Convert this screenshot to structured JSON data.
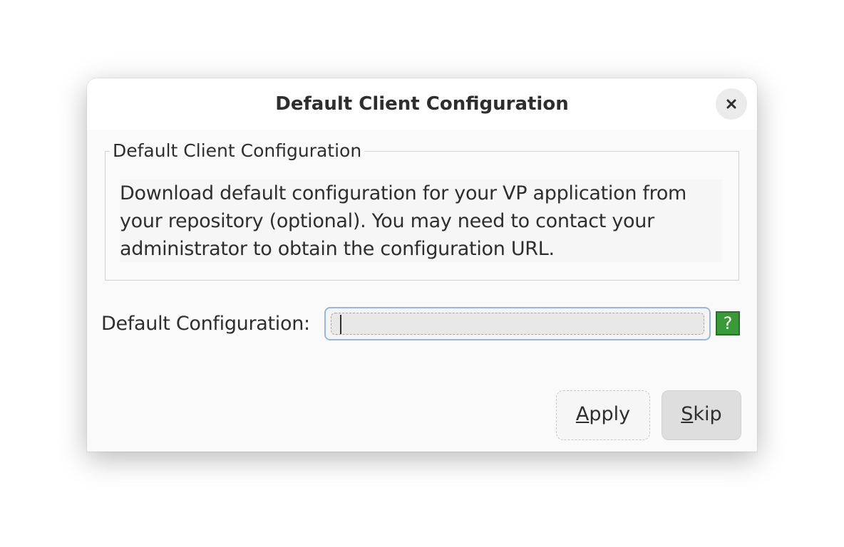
{
  "dialog": {
    "title": "Default Client Configuration",
    "close_icon": "close-icon"
  },
  "group": {
    "legend": "Default Client Configuration",
    "description_lines": [
      "Download default configuration for your VP application from",
      "your repository (optional). You may need to contact your",
      "administrator to obtain the configuration URL."
    ]
  },
  "field": {
    "label": "Default Configuration:",
    "value": "",
    "help_label": "?",
    "help_icon": "help-icon"
  },
  "buttons": {
    "apply_mnemonic": "A",
    "apply_rest": "pply",
    "skip_mnemonic": "S",
    "skip_rest": "kip"
  },
  "colors": {
    "help_button": "#3a9a3a",
    "input_focus_border": "#9ab6dd"
  }
}
